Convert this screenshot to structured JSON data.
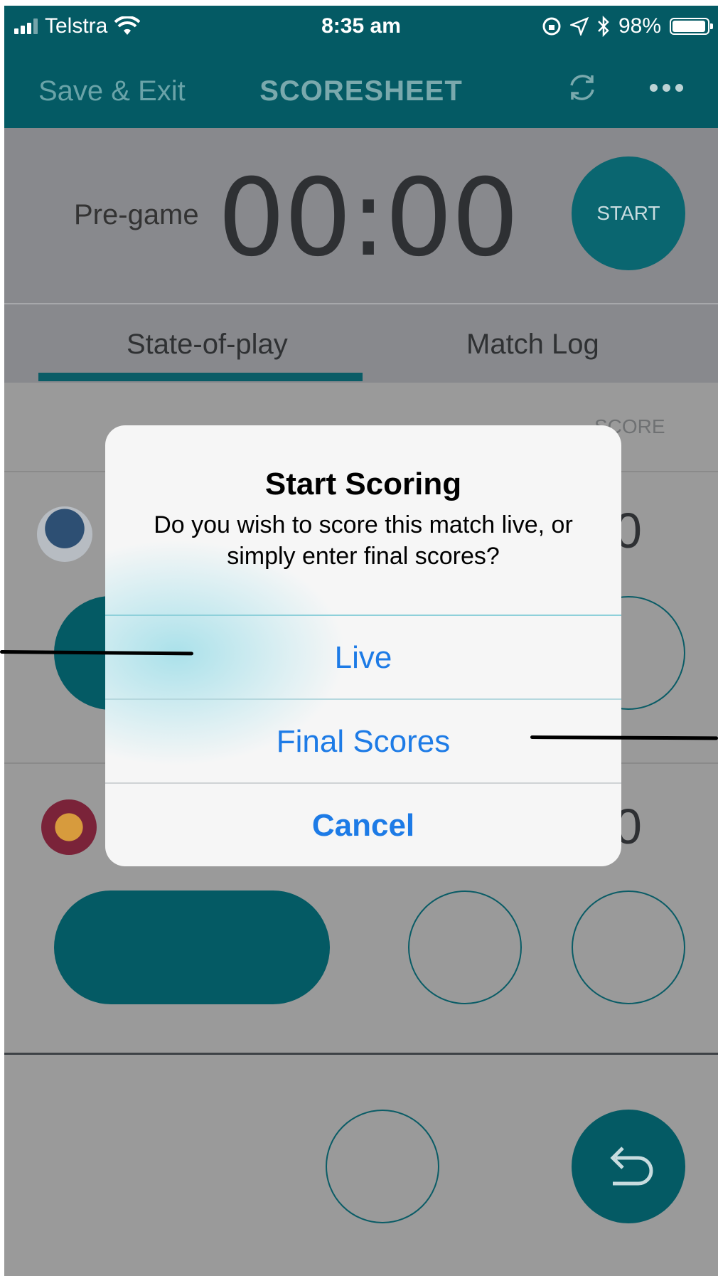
{
  "status_bar": {
    "carrier": "Telstra",
    "time": "8:35 am",
    "battery": "98%",
    "battery_level": 0.98
  },
  "nav": {
    "left_label": "Save & Exit",
    "title": "SCORESHEET",
    "icons": [
      "sync-icon",
      "more-icon"
    ]
  },
  "timer": {
    "phase": "Pre-game",
    "clock": "00:00",
    "start_label": "START"
  },
  "tabs": [
    {
      "label": "State-of-play",
      "active": true
    },
    {
      "label": "Match Log",
      "active": false
    }
  ],
  "table": {
    "score_header": "SCORE",
    "teams": [
      {
        "logo": "cougars-logo",
        "score": "0"
      },
      {
        "logo": "falcons-logo",
        "score": "0"
      }
    ]
  },
  "dialog": {
    "title": "Start Scoring",
    "message": "Do you wish to score this match live, or simply enter final scores?",
    "buttons": {
      "live": "Live",
      "final": "Final Scores",
      "cancel": "Cancel"
    }
  },
  "colors": {
    "brand_teal": "#045a64",
    "link_blue": "#1d7be6",
    "overlay_gray": "#9a9a9a"
  }
}
